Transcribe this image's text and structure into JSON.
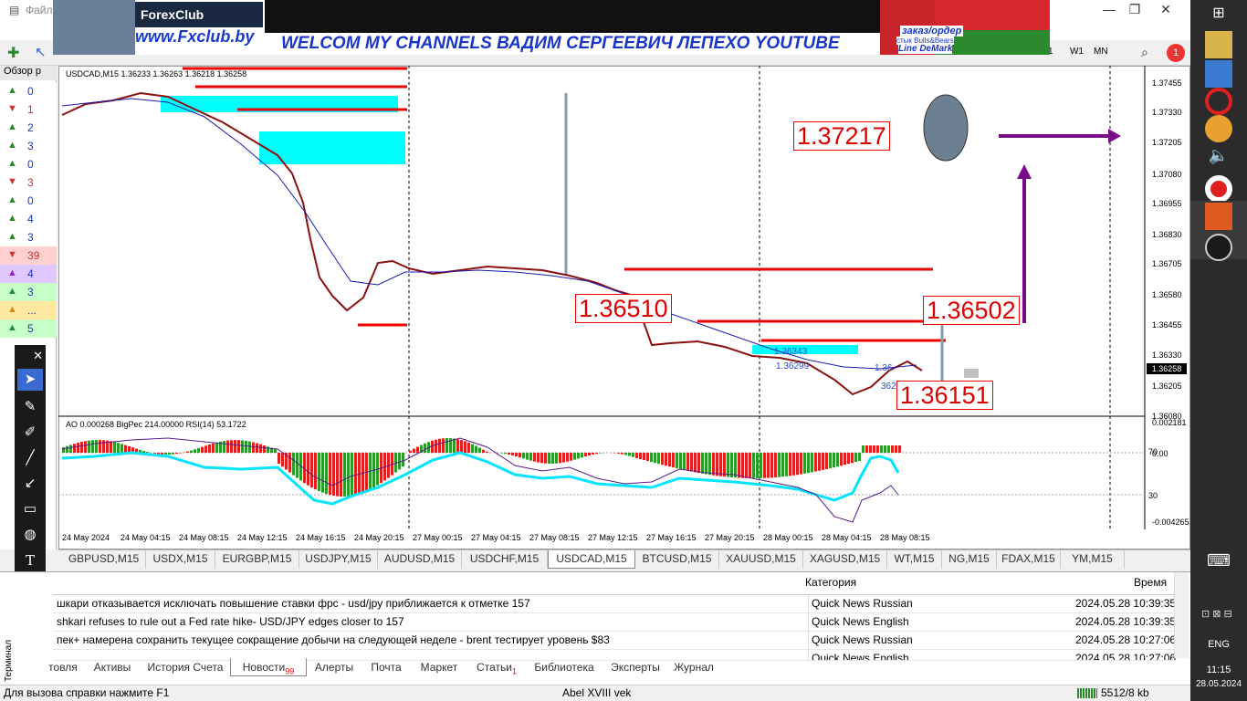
{
  "window": {
    "menu_file": "Файл",
    "minimize": "—",
    "restore": "❐",
    "close": "✕"
  },
  "banner": {
    "logo": "ForexClub",
    "site": "www.Fxclub.by",
    "headline": "WELCOM MY CHANNELS ВАДИМ СЕРГЕЕВИЧ ЛЕПЕХО YOUTUBE",
    "order_text": "заказ/ордер",
    "order_sub": "стык Bulls&Bears",
    "order_line": "Line DeMark"
  },
  "toolbar": {
    "timeframes": [
      "W1",
      "MN"
    ],
    "search_icon": "search-icon",
    "notif_count": "1"
  },
  "left_panel": {
    "tab": "Обзор р",
    "items": [
      "0",
      "1",
      "2",
      "3",
      "0",
      "3",
      "0",
      "4",
      "3",
      "39",
      "4",
      "3",
      "...",
      "5"
    ]
  },
  "chart": {
    "header": "USDCAD,M15  1.36233 1.36263 1.36218 1.36258",
    "current_price": "1.36258",
    "price_labels": [
      "1.37217",
      "1.36510",
      "1.36502",
      "1.36151"
    ],
    "small_labels": [
      "1.36343",
      "1.36299",
      "1.36",
      "362"
    ],
    "y_ticks": [
      "1.37455",
      "1.37330",
      "1.37205",
      "1.37080",
      "1.36955",
      "1.36830",
      "1.36705",
      "1.36580",
      "1.36455",
      "1.36330",
      "1.36258",
      "1.36205",
      "1.36080"
    ],
    "x_ticks": [
      "24 May 2024",
      "24 May 04:15",
      "24 May 08:15",
      "24 May 12:15",
      "24 May 16:15",
      "24 May 20:15",
      "27 May 00:15",
      "27 May 04:15",
      "27 May 08:15",
      "27 May 12:15",
      "27 May 16:15",
      "27 May 20:15",
      "28 May 00:15",
      "28 May 04:15",
      "28 May 08:15"
    ],
    "sub_header": "AO 0.000268  BigPec 214.00000  RSI(14) 53.1722",
    "sub_ticks": [
      "0.002181",
      "70",
      "0.00",
      "30",
      "-0.004265"
    ]
  },
  "chart_tabs": [
    "GBPUSD,M15",
    "USDX,M15",
    "EURGBP,M15",
    "USDJPY,M15",
    "AUDUSD,M15",
    "USDCHF,M15",
    "USDCAD,M15",
    "BTCUSD,M15",
    "XAUUSD,M15",
    "XAGUSD,M15",
    "WT,M15",
    "NG,M15",
    "FDAX,M15",
    "YM,M15"
  ],
  "active_chart_tab": "USDCAD,M15",
  "terminal": {
    "col_category": "Категория",
    "col_time": "Время",
    "rows": [
      {
        "title": "шкари отказывается исключать повышение ставки фрс - usd/jpy приближается к отметке 157",
        "category": "Quick News Russian",
        "time": "2024.05.28 10:39:35"
      },
      {
        "title": "shkari refuses to rule out a Fed rate hike- USD/JPY edges closer to 157",
        "category": "Quick News English",
        "time": "2024.05.28 10:39:35"
      },
      {
        "title": "пек+ намерена сохранить текущее сокращение добычи на следующей неделе - brent тестирует уровень $83",
        "category": "Quick News Russian",
        "time": "2024.05.28 10:27:06"
      },
      {
        "title": "",
        "category": "Quick News English",
        "time": "2024.05.28 10:27:06"
      }
    ],
    "tabs": [
      "товля",
      "Активы",
      "История Счета",
      "Новости",
      "Алерты",
      "Почта",
      "Маркет",
      "Статьи",
      "Библиотека",
      "Эксперты",
      "Журнал"
    ],
    "news_badge": "99",
    "articles_badge": "1",
    "side_label": "Терминал"
  },
  "status": {
    "help": "Для вызова справки нажмите F1",
    "profile": "Abel XVIII vek",
    "traffic": "5512/8 kb"
  },
  "taskbar": {
    "lang": "ENG",
    "time": "11:15",
    "date": "28.05.2024"
  }
}
